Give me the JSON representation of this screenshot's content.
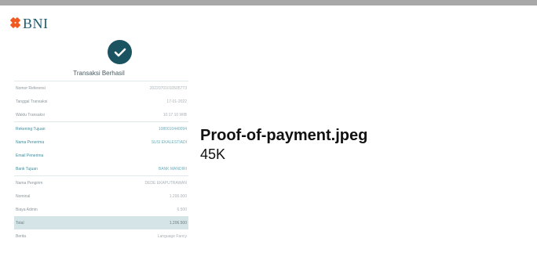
{
  "file": {
    "name": "Proof-of-payment.jpeg",
    "size": "45K"
  },
  "receipt": {
    "bank_logo": "BNI",
    "status_title": "Transaksi Berhasil",
    "groups": [
      {
        "kind": "meta",
        "rows": [
          {
            "label": "Nomor Referensi",
            "value": "20220701010505773"
          },
          {
            "label": "Tanggal Transaksi",
            "value": "17-01-2022"
          },
          {
            "label": "Waktu Transaksi",
            "value": "10:17:10 WIB"
          }
        ]
      },
      {
        "kind": "recipient",
        "rows": [
          {
            "label": "Rekening Tujuan",
            "value": "1080010440094"
          },
          {
            "label": "Nama Penerima",
            "value": "SUSI EKALESTIADI"
          },
          {
            "label": "Email Penerima",
            "value": ""
          },
          {
            "label": "Bank Tujuan",
            "value": "BANK MANDIRI"
          }
        ]
      },
      {
        "kind": "amount",
        "rows": [
          {
            "label": "Nama Pengirim",
            "value": "DEDE EKAPUTRAWAN"
          },
          {
            "label": "Nominal",
            "value": "1.200.000"
          },
          {
            "label": "Biaya Admin",
            "value": "6.500"
          },
          {
            "label": "Total",
            "value": "1.206.500",
            "highlight": true
          },
          {
            "label": "Berita",
            "value": "Language Fancy"
          }
        ]
      }
    ]
  },
  "colors": {
    "brand_teal": "#1b5360",
    "logo_orange": "#f05a22",
    "total_row_bg": "#d5e4e7"
  },
  "icons": [
    "bni-logo-icon",
    "check-circle-icon"
  ]
}
